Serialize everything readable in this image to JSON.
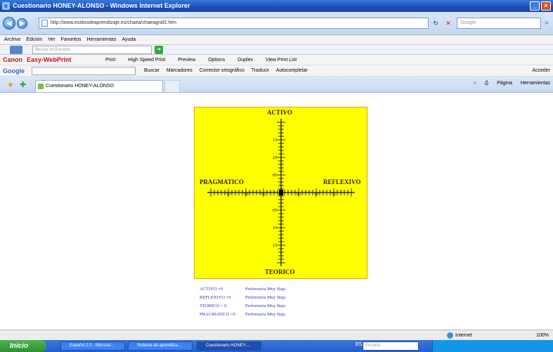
{
  "window": {
    "title": "Cuestionario HONEY-ALONSO - Windows Internet Explorer"
  },
  "address": {
    "url": "http://www.estilosdeaprendizaje.es/chaea/chaeagraf2.htm",
    "search_placeholder": "Google"
  },
  "menu": [
    "Archivo",
    "Edición",
    "Ver",
    "Favoritos",
    "Herramientas",
    "Ayuda"
  ],
  "toolbar1": {
    "search_placeholder": "Buscar en Encarta"
  },
  "toolbar2": {
    "brand1": "Canon",
    "brand2": "Easy-WebPrint",
    "items": [
      "Print",
      "High Speed Print",
      "Preview",
      "Options",
      "Duplex",
      "View Print List"
    ]
  },
  "toolbar3": {
    "brand": "Google",
    "items": [
      "Buscar",
      "Marcadores",
      "Corrector ortográfico",
      "Traducir",
      "Autocompletar"
    ],
    "right": "Acceder"
  },
  "tabs": [
    {
      "label": "Cuestionario HONEY-ALONSO"
    }
  ],
  "commandbar": {
    "page": "Página",
    "tools": "Herramientas"
  },
  "chart_data": {
    "type": "quadrant",
    "axes": {
      "top": "ACTIVO",
      "bottom": "TEORICO",
      "left": "PRAGMATICO",
      "right": "REFLEXIVO"
    },
    "range": [
      0,
      20
    ],
    "vertical_tick_labels": [
      {
        "label": "15",
        "value": 15,
        "dir": "up"
      },
      {
        "label": "10",
        "value": 10,
        "dir": "up"
      },
      {
        "label": "05",
        "value": 5,
        "dir": "up"
      },
      {
        "label": "05",
        "value": 5,
        "dir": "down"
      },
      {
        "label": "10",
        "value": 10,
        "dir": "down"
      },
      {
        "label": "15",
        "value": 15,
        "dir": "down"
      }
    ],
    "horizontal_tick_labels": [
      {
        "label": "15",
        "value": 15,
        "dir": "left"
      },
      {
        "label": "10",
        "value": 10,
        "dir": "left"
      },
      {
        "label": "05",
        "value": 5,
        "dir": "left"
      },
      {
        "label": "05",
        "value": 5,
        "dir": "right"
      },
      {
        "label": "10",
        "value": 10,
        "dir": "right"
      },
      {
        "label": "15",
        "value": 15,
        "dir": "right"
      }
    ],
    "values": {
      "ACTIVO": 0,
      "REFLEXIVO": 0,
      "TEORICO": 0,
      "PRAGMATICO": 0
    },
    "colors": {
      "background": "#ffff00",
      "border": "#e8a200",
      "axis": "#000000",
      "marker": "#000000"
    }
  },
  "results": [
    {
      "name": "ACTIVO =0",
      "pref": "Preferencia Muy Baja"
    },
    {
      "name": "REFLEXIVO =0",
      "pref": "Preferencia Muy Baja"
    },
    {
      "name": "TEORICO = 0",
      "pref": "Preferencia Muy Baja"
    },
    {
      "name": "PRAGMATICO =0",
      "pref": "Preferencia Muy Baja"
    }
  ],
  "status": {
    "zone": "Internet",
    "zoom": "100%"
  },
  "taskbar": {
    "start": "Inicio",
    "tasks": [
      "Español 2.0 - Microso...",
      "Sistema de aprendiza...",
      "Cuestionario HONEY-..."
    ],
    "lang": "ES",
    "encarta_placeholder": "Encarta"
  }
}
